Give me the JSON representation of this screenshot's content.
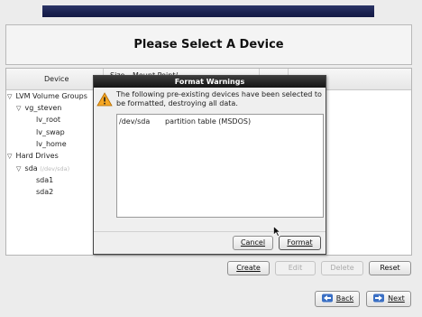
{
  "page": {
    "title": "Please Select A Device"
  },
  "table": {
    "columns": {
      "device": "Device",
      "size": "Size",
      "mount_point": "Mount Point/"
    },
    "rows": [
      {
        "label": "LVM Volume Groups",
        "expander": true
      },
      {
        "label": "vg_steven",
        "expander": true
      },
      {
        "label": "lv_root"
      },
      {
        "label": "lv_swap"
      },
      {
        "label": "lv_home"
      },
      {
        "label": "Hard Drives",
        "expander": true
      },
      {
        "label": "sda",
        "sublabel": "(/dev/sda)",
        "expander": true
      },
      {
        "label": "sda1"
      },
      {
        "label": "sda2"
      }
    ]
  },
  "actions": {
    "create": "Create",
    "edit": "Edit",
    "delete": "Delete",
    "reset": "Reset"
  },
  "nav": {
    "back": "Back",
    "next": "Next"
  },
  "dialog": {
    "title": "Format Warnings",
    "message": "The following pre-existing devices have been selected to be formatted, destroying all data.",
    "items": [
      {
        "device": "/dev/sda",
        "description": "partition table (MSDOS)"
      }
    ],
    "cancel": "Cancel",
    "format": "Format"
  },
  "icons": {
    "warning": "warning-icon",
    "back": "back-arrow-icon",
    "next": "next-arrow-icon",
    "expander": "expander-arrow-icon",
    "cursor": "mouse-cursor-icon"
  },
  "colors": {
    "banner": "#1a2150",
    "warning": "#f5a623",
    "nav_arrow": "#3a6fc4"
  }
}
